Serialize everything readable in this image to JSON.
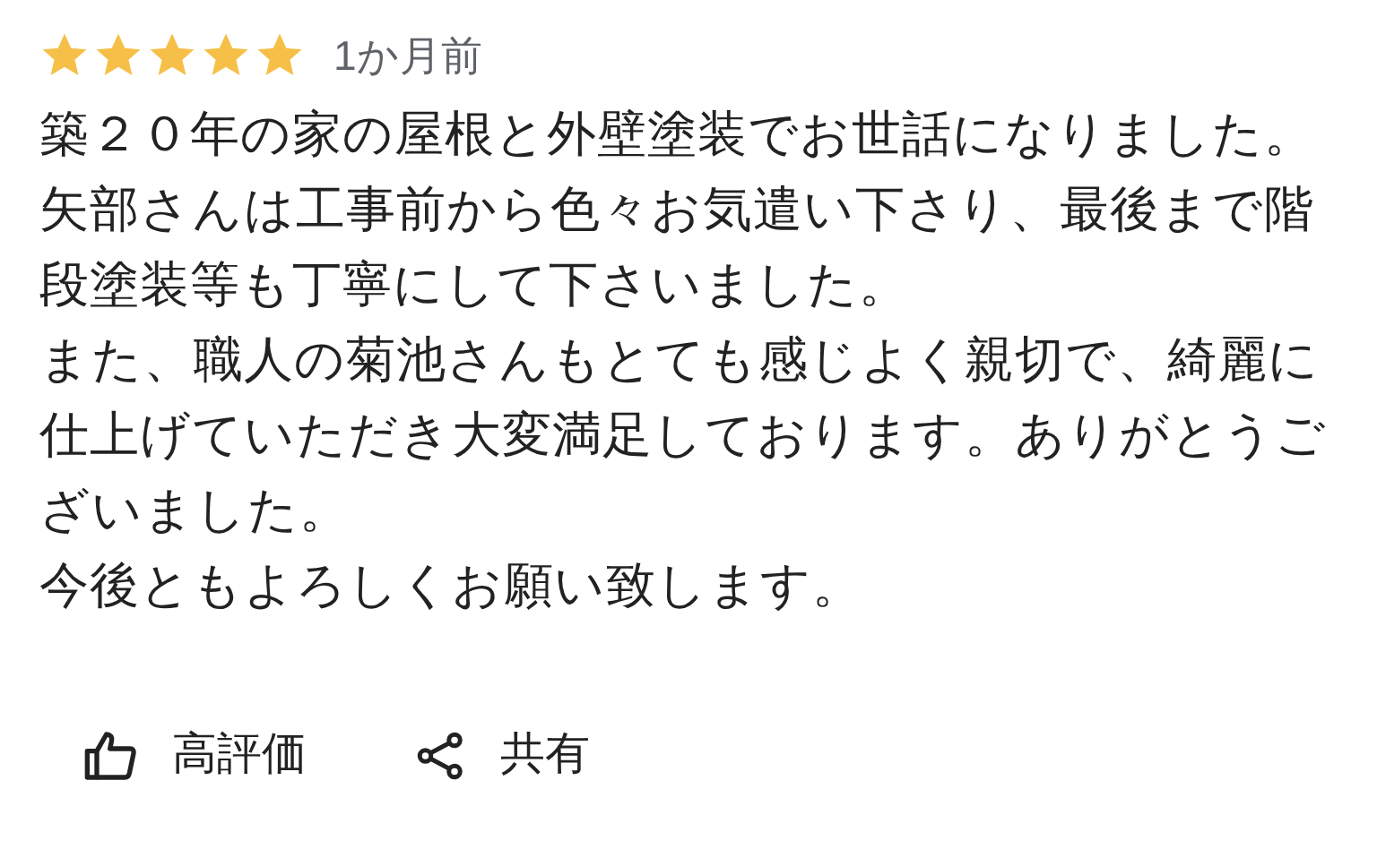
{
  "rating": {
    "stars": 5,
    "time": "1か月前"
  },
  "review": {
    "paragraphs": [
      "築２０年の家の屋根と外壁塗装でお世話になりました。",
      "矢部さんは工事前から色々お気遣い下さり、最後まで階段塗装等も丁寧にして下さいました。",
      "また、職人の菊池さんもとても感じよく親切で、綺麗に仕上げていただき大変満足しております。ありがとうございました。",
      "今後ともよろしくお願い致します。"
    ]
  },
  "actions": [
    {
      "kind": "like",
      "label": "高評価"
    },
    {
      "kind": "share",
      "label": "共有"
    }
  ]
}
